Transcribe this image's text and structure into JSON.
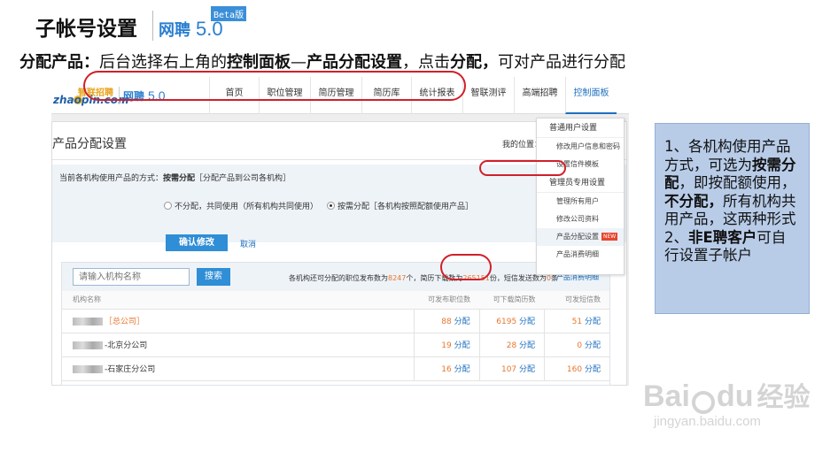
{
  "slide": {
    "title": "子帐号设置",
    "logo_brand": "网聘",
    "logo_version": "5.0",
    "logo_badge": "Beta版",
    "subtitle_parts": [
      {
        "text": "分配产品：",
        "bold": true
      },
      {
        "text": "后台选择右上角的",
        "bold": false
      },
      {
        "text": "控制面板",
        "bold": true
      },
      {
        "text": "—",
        "bold": false
      },
      {
        "text": "产品分配设置",
        "bold": true
      },
      {
        "text": "，点击",
        "bold": false
      },
      {
        "text": "分配，",
        "bold": true
      },
      {
        "text": "可对产品进行分配",
        "bold": false
      }
    ]
  },
  "screenshot": {
    "brand_top": "智联招聘",
    "brand_domain": "zhaopin.com",
    "nav_logo_brand": "网聘",
    "nav_logo_version": "5.0",
    "nav": [
      {
        "label": "首页",
        "active": false
      },
      {
        "label": "职位管理",
        "active": false
      },
      {
        "label": "简历管理",
        "active": false
      },
      {
        "label": "简历库",
        "active": false
      },
      {
        "label": "统计报表",
        "active": false
      },
      {
        "label": "智联测评",
        "active": false
      },
      {
        "label": "高端招聘",
        "active": false
      },
      {
        "label": "控制面板",
        "active": true
      }
    ],
    "panel_title": "产品分配设置",
    "position_label": "我的位置：",
    "method_label_prefix": "当前各机构使用产品的方式：",
    "method_value": "按需分配",
    "method_desc": "［分配产品到公司各机构］",
    "radio_options": [
      {
        "label": "不分配，共同使用（所有机构共同使用）",
        "selected": false
      },
      {
        "label": "按需分配［各机构按照配额使用产品］",
        "selected": true
      }
    ],
    "confirm_label": "确认修改",
    "cancel_label": "取消",
    "search_placeholder": "请输入机构名称",
    "search_button": "搜索",
    "quota_text": {
      "p1": "各机构还可分配的职位发布数为",
      "n1": "8247",
      "p2": "个，简历下载数为",
      "n2": "265151",
      "p3": "份，短信发送数为",
      "n3": "0",
      "p4": "条"
    },
    "detail_link": "产品消费明细",
    "table": {
      "headers": [
        "机构名称",
        "可发布职位数",
        "可下载简历数",
        "可发短信数"
      ],
      "rows": [
        {
          "name_suffix": "［总公司］",
          "name_orange": true,
          "jobs": "88",
          "resumes": "6195",
          "sms": "51"
        },
        {
          "name_suffix": "-北京分公司",
          "name_orange": false,
          "jobs": "19",
          "resumes": "28",
          "sms": "0"
        },
        {
          "name_suffix": "-石家庄分公司",
          "name_orange": false,
          "jobs": "16",
          "resumes": "107",
          "sms": "160"
        }
      ],
      "assign_label": "分配"
    },
    "dropdown": {
      "sections": [
        {
          "heading": "普通用户设置",
          "items": [
            {
              "label": "修改用户信息和密码",
              "active": false,
              "hot": false
            },
            {
              "label": "设置信件模板",
              "active": false,
              "hot": false
            }
          ]
        },
        {
          "heading": "管理员专用设置",
          "items": [
            {
              "label": "管理所有用户",
              "active": false,
              "hot": false
            },
            {
              "label": "修改公司资料",
              "active": false,
              "hot": false
            },
            {
              "label": "产品分配设置",
              "active": true,
              "hot": true
            },
            {
              "label": "产品消费明细",
              "active": false,
              "hot": false
            }
          ]
        }
      ],
      "hot_badge": "NEW"
    }
  },
  "callout": {
    "parts": [
      {
        "text": "1、各机构使用产品方式，可选为",
        "bold": false
      },
      {
        "text": "按需分配",
        "bold": true
      },
      {
        "text": "，即按配额使用，",
        "bold": false
      },
      {
        "text": "不分配，",
        "bold": true
      },
      {
        "text": "所有机构共用产品，这两种形式",
        "bold": false
      },
      {
        "text": "\n2、",
        "bold": false
      },
      {
        "text": "非E聘客户",
        "bold": true
      },
      {
        "text": "可自行设置子帐户",
        "bold": false
      }
    ]
  },
  "watermark": {
    "bai": "Bai",
    "du": "du",
    "jingyan": "经验",
    "url": "jingyan.baidu.com"
  },
  "colors": {
    "accent_blue": "#2f8ed6",
    "highlight_red": "#d0202a",
    "callout_bg": "#b8cce8",
    "number_orange": "#e8762d"
  }
}
